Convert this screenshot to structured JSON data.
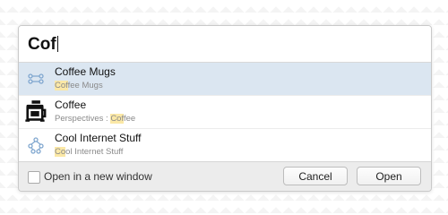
{
  "search": {
    "query": "Cof"
  },
  "results": [
    {
      "title": "Coffee Mugs",
      "subtitle_highlight": "Cof",
      "subtitle_rest": "fee Mugs",
      "selected": true,
      "icon": "project-nodes-icon"
    },
    {
      "title": "Coffee",
      "subtitle_prefix": "Perspectives : ",
      "subtitle_highlight": "Cof",
      "subtitle_rest": "fee",
      "icon": "coffee-press-icon"
    },
    {
      "title": "Cool Internet Stuff",
      "subtitle_highlight": "Co",
      "subtitle_rest": "ol Internet Stuff",
      "icon": "folder-tree-icon"
    }
  ],
  "footer": {
    "checkbox_label": "Open in a new window",
    "cancel_label": "Cancel",
    "open_label": "Open"
  },
  "colors": {
    "selection": "#dbe6f1",
    "highlight": "#fbe8a6",
    "icon_blue": "#7fa6cf"
  }
}
